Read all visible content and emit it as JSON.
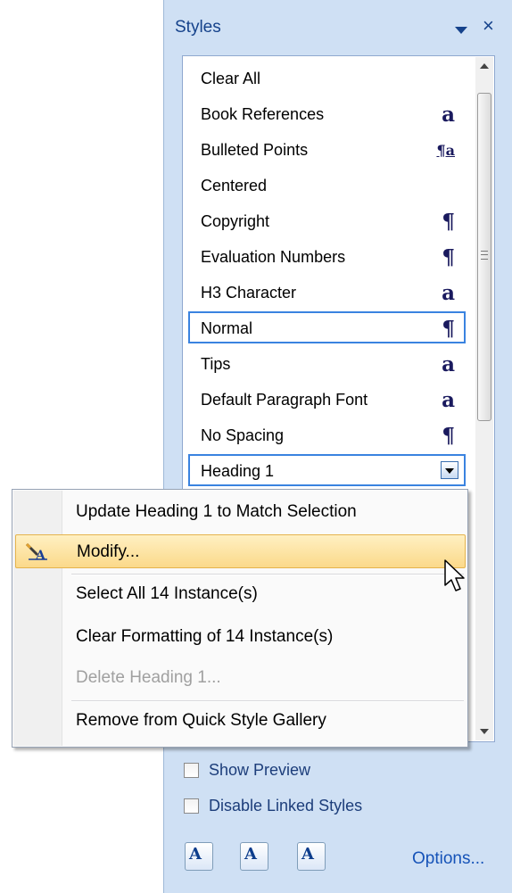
{
  "pane": {
    "title": "Styles",
    "close_glyph": "×",
    "styles": [
      {
        "label": "Clear All",
        "glyph": ""
      },
      {
        "label": "Book References",
        "glyph": "a"
      },
      {
        "label": "Bulleted Points",
        "glyph": "¶a"
      },
      {
        "label": "Centered",
        "glyph": ""
      },
      {
        "label": "Copyright",
        "glyph": "¶"
      },
      {
        "label": "Evaluation Numbers",
        "glyph": "¶"
      },
      {
        "label": "H3 Character",
        "glyph": "a"
      },
      {
        "label": "Normal",
        "glyph": "¶"
      },
      {
        "label": "Tips",
        "glyph": "a"
      },
      {
        "label": "Default Paragraph Font",
        "glyph": "a"
      },
      {
        "label": "No Spacing",
        "glyph": "¶"
      },
      {
        "label": "Heading 1",
        "glyph": ""
      }
    ],
    "show_preview_label": "Show Preview",
    "disable_linked_label": "Disable Linked Styles",
    "new_style_glyph": "A",
    "inspector_glyph": "A",
    "manage_glyph": "A",
    "options_label": "Options..."
  },
  "menu": {
    "items": [
      {
        "label": "Update Heading 1 to Match Selection"
      },
      {
        "label": "Modify..."
      },
      {
        "label": "Select All 14 Instance(s)"
      },
      {
        "label": "Clear Formatting of 14 Instance(s)"
      },
      {
        "label": "Delete Heading 1..."
      },
      {
        "label": "Remove from Quick Style Gallery"
      }
    ]
  },
  "colors": {
    "pane_bg": "#cfe0f4",
    "accent_text": "#15428b",
    "selection_border": "#3a83e0",
    "menu_hot": "#fbd98a"
  }
}
